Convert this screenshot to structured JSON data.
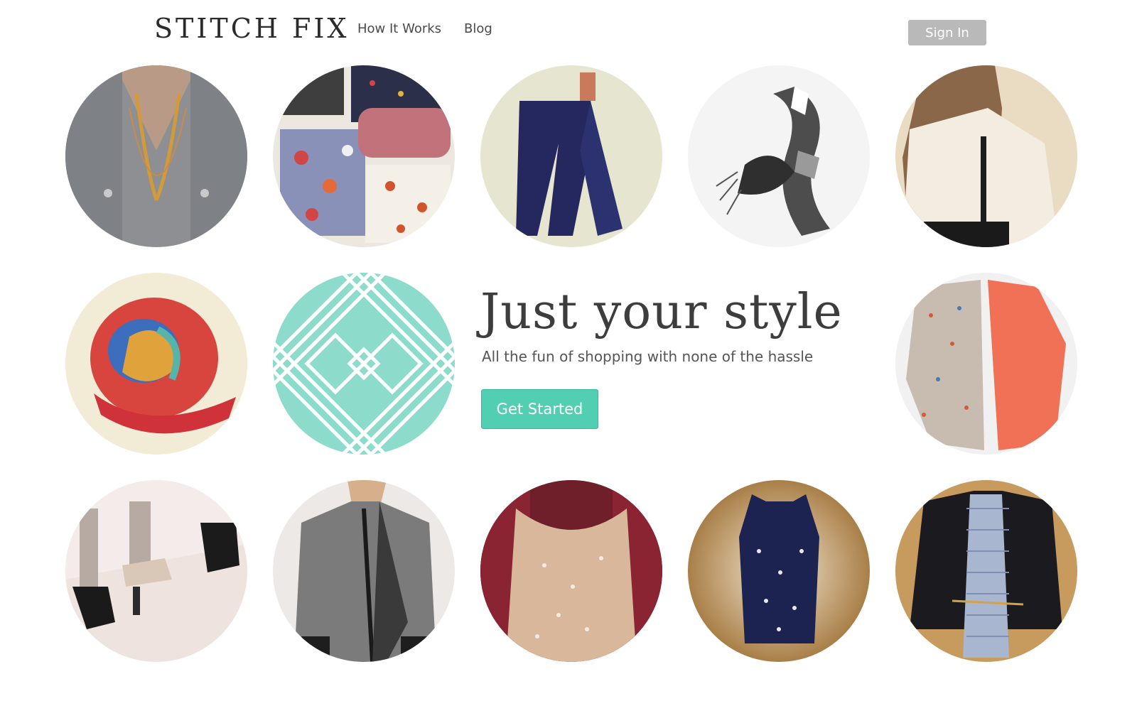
{
  "header": {
    "logo": "STITCH FIX",
    "nav": [
      {
        "label": "How It Works"
      },
      {
        "label": "Blog"
      }
    ],
    "sign_in_label": "Sign In"
  },
  "hero": {
    "title": "Just your style",
    "subtitle": "All the fun of shopping with none of the hassle",
    "cta_label": "Get Started"
  },
  "colors": {
    "accent": "#52cfb3",
    "signin_bg": "#b9b9b9",
    "text_dark": "#3d3d3d"
  },
  "tiles": [
    {
      "name": "photo-chambray-shirt-necklace"
    },
    {
      "name": "photo-floral-prints"
    },
    {
      "name": "photo-jeans"
    },
    {
      "name": "photo-plaid-scarf"
    },
    {
      "name": "photo-cream-blouse"
    },
    {
      "name": "photo-colorful-scarf"
    },
    {
      "name": "logo-pattern-mark"
    },
    {
      "name": "photo-polka-blouses"
    },
    {
      "name": "photo-heels"
    },
    {
      "name": "photo-grey-jacket"
    },
    {
      "name": "photo-dotted-scarf"
    },
    {
      "name": "photo-polka-tank"
    },
    {
      "name": "photo-blazer-gingham"
    }
  ]
}
